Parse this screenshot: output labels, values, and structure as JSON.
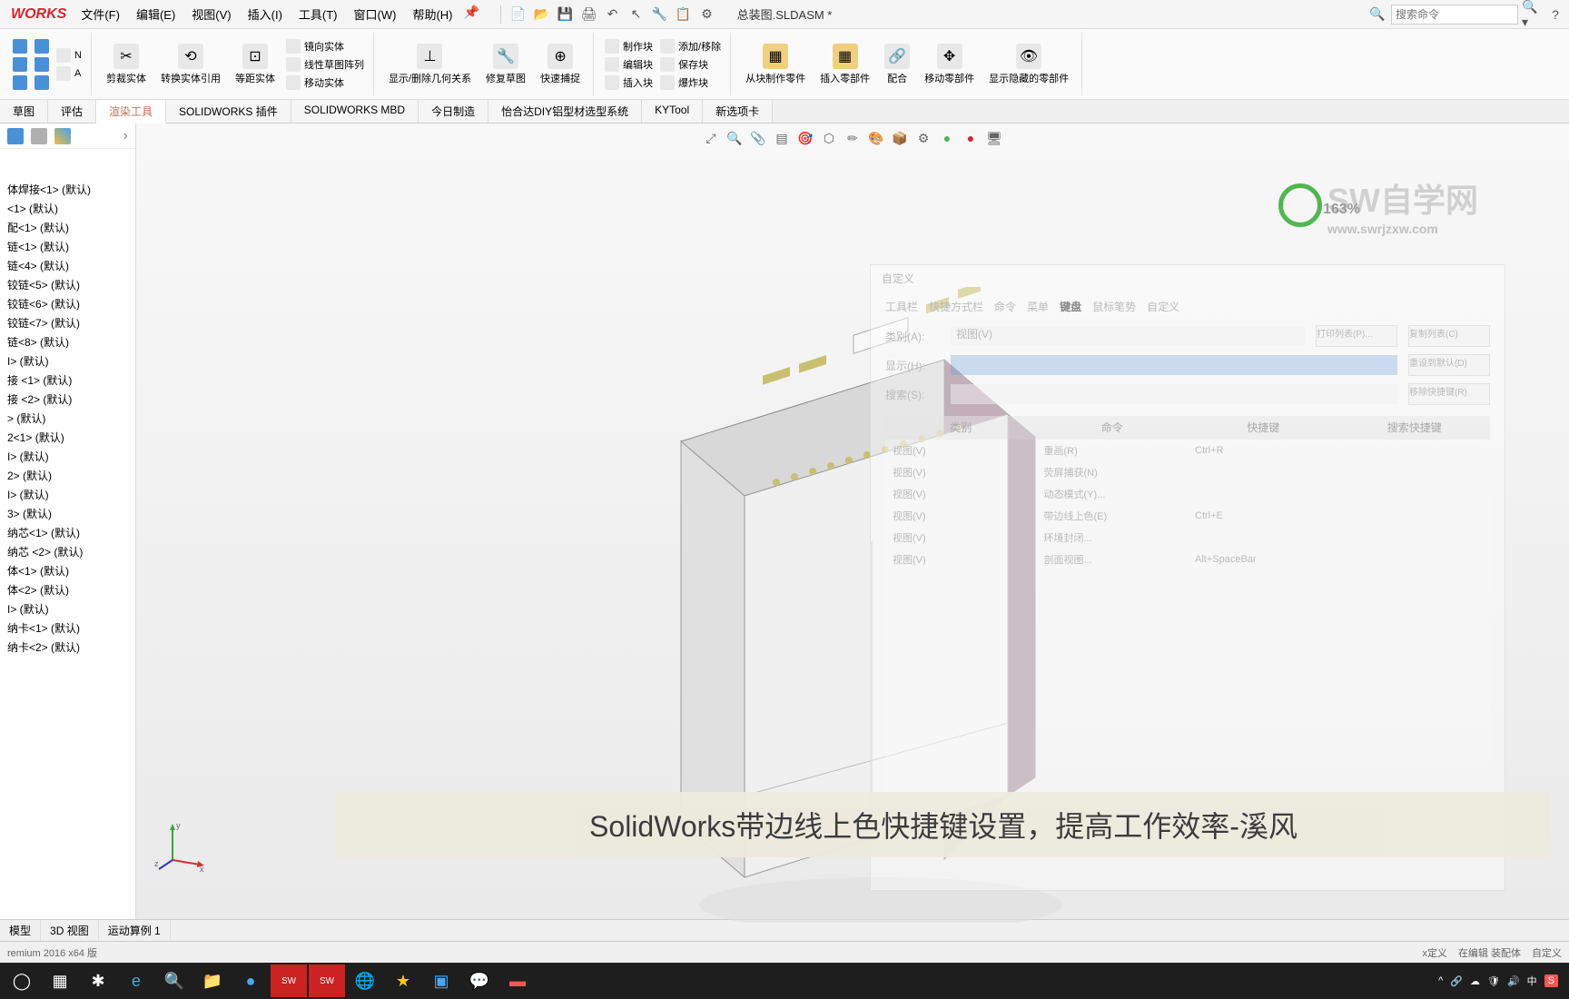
{
  "app": {
    "logo": "WORKS",
    "doc_title": "总装图.SLDASM *"
  },
  "menu": [
    "文件(F)",
    "编辑(E)",
    "视图(V)",
    "插入(I)",
    "工具(T)",
    "窗口(W)",
    "帮助(H)"
  ],
  "search": {
    "placeholder": "搜索命令"
  },
  "ribbon": {
    "g1": [
      "剪裁实体",
      "转换实体引用",
      "等距实体"
    ],
    "g1b": [
      "镜向实体",
      "线性草图阵列",
      "移动实体"
    ],
    "g2": [
      "显示/删除几何关系",
      "修复草图",
      "快速捕捉"
    ],
    "g3": [
      "制作块",
      "编辑块",
      "插入块"
    ],
    "g3b": [
      "添加/移除",
      "保存块",
      "爆炸块"
    ],
    "g4": [
      "从块制作零件",
      "插入零部件",
      "配合",
      "移动零部件",
      "显示隐藏的零部件"
    ]
  },
  "tabs": [
    "草图",
    "评估",
    "渲染工具",
    "SOLIDWORKS 插件",
    "SOLIDWORKS MBD",
    "今日制造",
    "怡合达DIY铝型材选型系统",
    "KYTool",
    "新选项卡"
  ],
  "active_tab": 2,
  "tree": [
    "体焊接<1> (默认)",
    "<1> (默认)",
    "配<1> (默认)",
    "链<1> (默认)",
    "链<4> (默认)",
    "铰链<5> (默认)",
    "铰链<6> (默认)",
    "铰链<7> (默认)",
    "链<8> (默认)",
    "I> (默认)",
    "接 <1> (默认)",
    "接 <2> (默认)",
    "> (默认)",
    "2<1> (默认)",
    "I> (默认)",
    "2> (默认)",
    "I> (默认)",
    "3> (默认)",
    "纳芯<1> (默认)",
    "纳芯 <2> (默认)",
    "体<1> (默认)",
    "体<2> (默认)",
    "I> (默认)",
    "纳卡<1> (默认)",
    "纳卡<2> (默认)"
  ],
  "zoom": "163%",
  "watermark": {
    "text": "SW自学网",
    "url": "www.swrjzxw.com"
  },
  "dialog": {
    "title": "自定义",
    "tabs": [
      "工具栏",
      "快捷方式栏",
      "命令",
      "菜单",
      "键盘",
      "鼠标笔势",
      "自定义"
    ],
    "cat_label": "类别(A):",
    "cat_value": "视图(V)",
    "show_label": "显示(H):",
    "search_label": "搜索(S):",
    "btns": [
      "打印列表(P)...",
      "复制列表(C)",
      "重设到默认(D)",
      "移除快捷键(R)"
    ],
    "headers": [
      "类别",
      "命令",
      "快捷键",
      "搜索快捷键"
    ],
    "rows": [
      [
        "视图(V)",
        "重画(R)",
        "Ctrl+R",
        ""
      ],
      [
        "视图(V)",
        "荧屏捕获(N)",
        "",
        " "
      ],
      [
        "视图(V)",
        "动态模式(Y)...",
        "",
        " "
      ],
      [
        "视图(V)",
        "带边线上色(E)",
        "Ctrl+E",
        ""
      ],
      [
        "视图(V)",
        "环境封闭...",
        "",
        " "
      ],
      [
        "视图(V)",
        "剖面视图...",
        "Alt+SpaceBar",
        ""
      ]
    ]
  },
  "subtitle": "SolidWorks带边线上色快捷键设置，提高工作效率-溪风",
  "bottom_tabs": [
    "模型",
    "3D 视图",
    "运动算例 1"
  ],
  "status": {
    "left": "remium 2016 x64 版",
    "items": [
      "x定义",
      "在编辑 装配体",
      "自定义"
    ]
  },
  "tray": {
    "ime": "中",
    "sogou": "S"
  }
}
